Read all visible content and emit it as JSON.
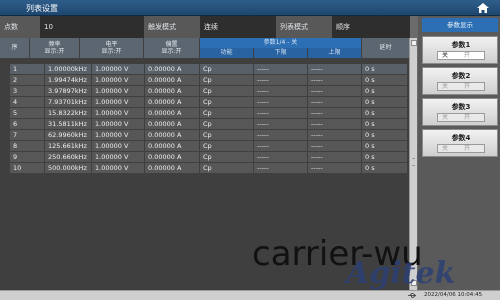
{
  "window": {
    "title": "列表设置",
    "home_icon": "home-icon"
  },
  "topinfo": {
    "points_label": "点数",
    "points_value": "10",
    "trigger_label": "触发模式",
    "trigger_value": "连续",
    "list_mode_label": "列表模式",
    "list_mode_value": "顺序"
  },
  "table": {
    "col_index": "序",
    "col_freq": [
      "频率",
      "显示:开"
    ],
    "col_level": [
      "电平",
      "显示:开"
    ],
    "col_bias": [
      "偏置",
      "显示:开"
    ],
    "param_group": "参数1/4 - 关",
    "param_func": "功能",
    "param_low": "下限",
    "param_high": "上限",
    "col_delay": "延时",
    "rows": [
      {
        "idx": "1",
        "freq": "1.00000kHz",
        "level": "1.00000 V",
        "bias": "0.00000 A",
        "func": "Cp",
        "low": "-----",
        "high": "-----",
        "delay": "0 s"
      },
      {
        "idx": "2",
        "freq": "1.99474kHz",
        "level": "1.00000 V",
        "bias": "0.00000 A",
        "func": "Cp",
        "low": "-----",
        "high": "-----",
        "delay": "0 s"
      },
      {
        "idx": "3",
        "freq": "3.97897kHz",
        "level": "1.00000 V",
        "bias": "0.00000 A",
        "func": "Cp",
        "low": "-----",
        "high": "-----",
        "delay": "0 s"
      },
      {
        "idx": "4",
        "freq": "7.93701kHz",
        "level": "1.00000 V",
        "bias": "0.00000 A",
        "func": "Cp",
        "low": "-----",
        "high": "-----",
        "delay": "0 s"
      },
      {
        "idx": "5",
        "freq": "15.8322kHz",
        "level": "1.00000 V",
        "bias": "0.00000 A",
        "func": "Cp",
        "low": "-----",
        "high": "-----",
        "delay": "0 s"
      },
      {
        "idx": "6",
        "freq": "31.5811kHz",
        "level": "1.00000 V",
        "bias": "0.00000 A",
        "func": "Cp",
        "low": "-----",
        "high": "-----",
        "delay": "0 s"
      },
      {
        "idx": "7",
        "freq": "62.9960kHz",
        "level": "1.00000 V",
        "bias": "0.00000 A",
        "func": "Cp",
        "low": "-----",
        "high": "-----",
        "delay": "0 s"
      },
      {
        "idx": "8",
        "freq": "125.661kHz",
        "level": "1.00000 V",
        "bias": "0.00000 A",
        "func": "Cp",
        "low": "-----",
        "high": "-----",
        "delay": "0 s"
      },
      {
        "idx": "9",
        "freq": "250.660kHz",
        "level": "1.00000 V",
        "bias": "0.00000 A",
        "func": "Cp",
        "low": "-----",
        "high": "-----",
        "delay": "0 s"
      },
      {
        "idx": "10",
        "freq": "500.000kHz",
        "level": "1.00000 V",
        "bias": "0.00000 A",
        "func": "Cp",
        "low": "-----",
        "high": "-----",
        "delay": "0 s"
      }
    ]
  },
  "right_panel": {
    "header": "参数显示",
    "buttons": [
      {
        "name": "参数1",
        "off": "关",
        "on": "开",
        "state": "off"
      },
      {
        "name": "参数2",
        "off": "关",
        "on": "开",
        "state": "off"
      },
      {
        "name": "参数3",
        "off": "关",
        "on": "开",
        "state": "off"
      },
      {
        "name": "参数4",
        "off": "关",
        "on": "开",
        "state": "off"
      }
    ]
  },
  "overlay": {
    "watermark": "carrier-wu",
    "logo": "Agitek"
  },
  "statusbar": {
    "usb_icon": "usb-icon",
    "datetime": "2022/04/06 10:04:45"
  },
  "colors": {
    "accent": "#2c6fb4",
    "titlebar": "#2f5d8a",
    "logo": "#2c3f75"
  }
}
